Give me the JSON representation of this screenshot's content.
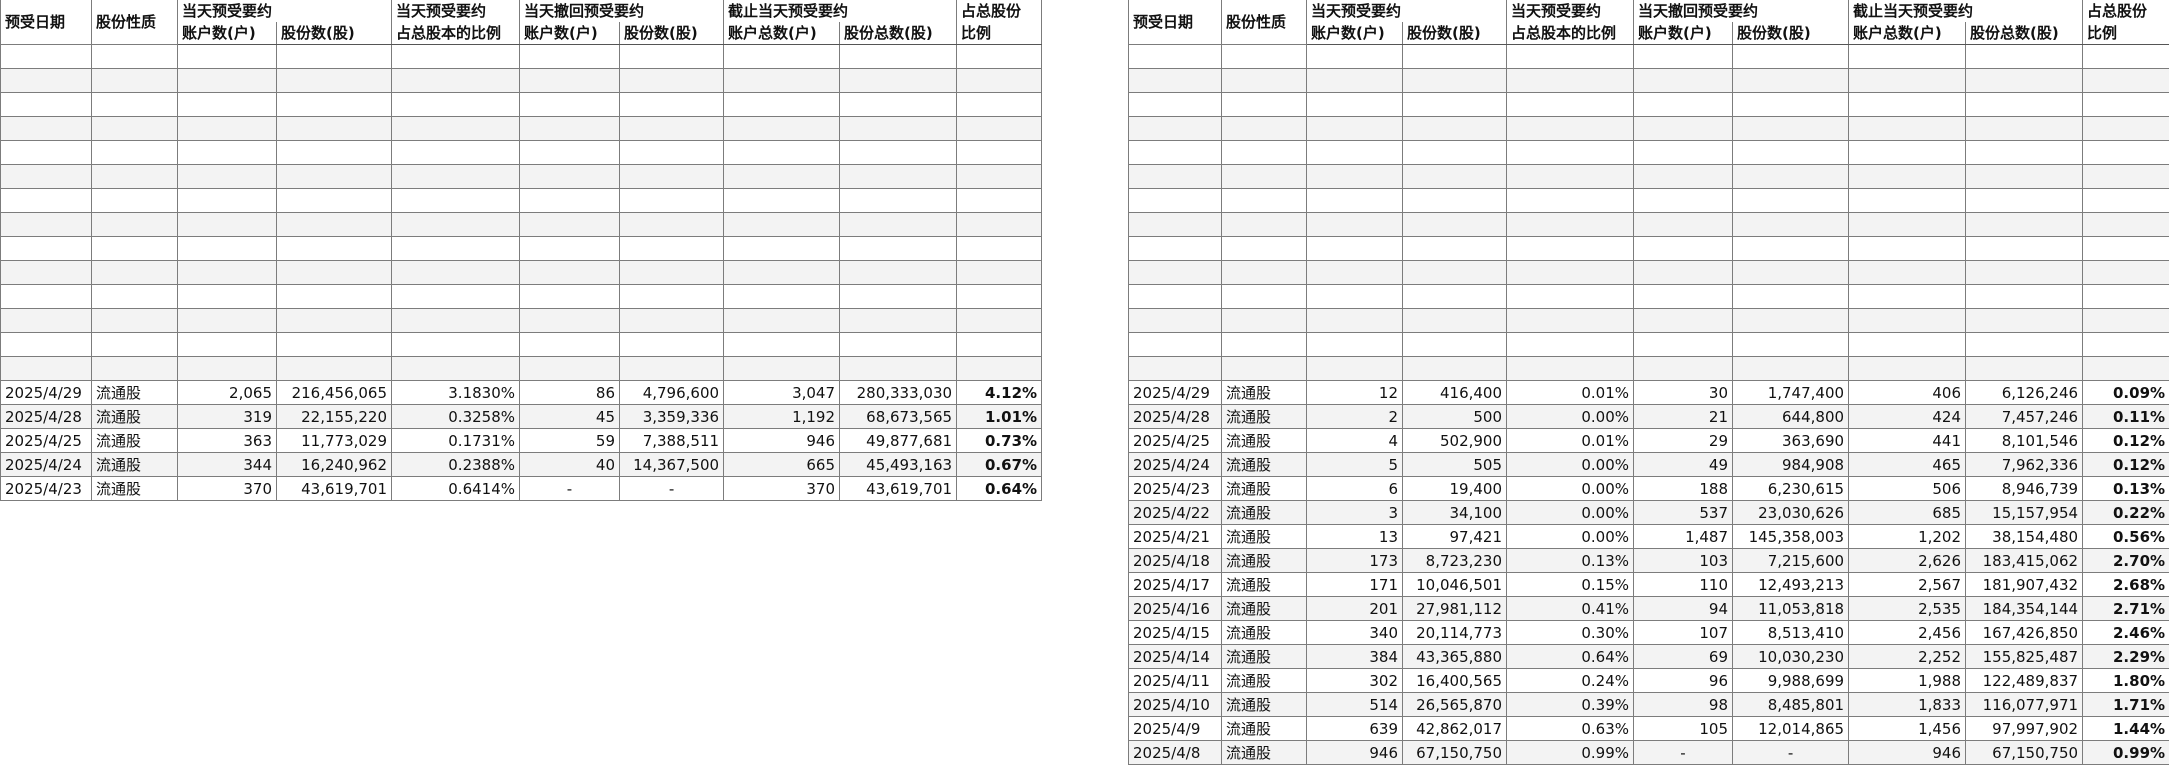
{
  "headers": {
    "date": "预受日期",
    "nature": "股份性质",
    "group_today": "当天预受要约",
    "group_ratio_a": "当天预受要约",
    "group_ratio_b": "占总股本的比例",
    "group_withdraw": "当天撤回预受要约",
    "group_cumulative": "截止当天预受要约",
    "group_total_a": "占总股份",
    "group_total_b": "比例",
    "accounts": "账户数(户)",
    "shares": "股份数(股)",
    "total_accounts": "账户总数(户)",
    "total_shares": "股份总数(股)"
  },
  "left_table": {
    "rows": [
      {
        "date": "2025/4/29",
        "nature": "流通股",
        "accounts": "2,065",
        "shares": "216,456,065",
        "ratio": "3.1830%",
        "w_accounts": "86",
        "w_shares": "4,796,600",
        "t_accounts": "3,047",
        "t_shares": "280,333,030",
        "total_ratio": "4.12%"
      },
      {
        "date": "2025/4/28",
        "nature": "流通股",
        "accounts": "319",
        "shares": "22,155,220",
        "ratio": "0.3258%",
        "w_accounts": "45",
        "w_shares": "3,359,336",
        "t_accounts": "1,192",
        "t_shares": "68,673,565",
        "total_ratio": "1.01%"
      },
      {
        "date": "2025/4/25",
        "nature": "流通股",
        "accounts": "363",
        "shares": "11,773,029",
        "ratio": "0.1731%",
        "w_accounts": "59",
        "w_shares": "7,388,511",
        "t_accounts": "946",
        "t_shares": "49,877,681",
        "total_ratio": "0.73%"
      },
      {
        "date": "2025/4/24",
        "nature": "流通股",
        "accounts": "344",
        "shares": "16,240,962",
        "ratio": "0.2388%",
        "w_accounts": "40",
        "w_shares": "14,367,500",
        "t_accounts": "665",
        "t_shares": "45,493,163",
        "total_ratio": "0.67%"
      },
      {
        "date": "2025/4/23",
        "nature": "流通股",
        "accounts": "370",
        "shares": "43,619,701",
        "ratio": "0.6414%",
        "w_accounts": "-",
        "w_shares": "-",
        "t_accounts": "370",
        "t_shares": "43,619,701",
        "total_ratio": "0.64%"
      }
    ]
  },
  "right_table": {
    "rows": [
      {
        "date": "2025/4/29",
        "nature": "流通股",
        "accounts": "12",
        "shares": "416,400",
        "ratio": "0.01%",
        "w_accounts": "30",
        "w_shares": "1,747,400",
        "t_accounts": "406",
        "t_shares": "6,126,246",
        "total_ratio": "0.09%"
      },
      {
        "date": "2025/4/28",
        "nature": "流通股",
        "accounts": "2",
        "shares": "500",
        "ratio": "0.00%",
        "w_accounts": "21",
        "w_shares": "644,800",
        "t_accounts": "424",
        "t_shares": "7,457,246",
        "total_ratio": "0.11%"
      },
      {
        "date": "2025/4/25",
        "nature": "流通股",
        "accounts": "4",
        "shares": "502,900",
        "ratio": "0.01%",
        "w_accounts": "29",
        "w_shares": "363,690",
        "t_accounts": "441",
        "t_shares": "8,101,546",
        "total_ratio": "0.12%"
      },
      {
        "date": "2025/4/24",
        "nature": "流通股",
        "accounts": "5",
        "shares": "505",
        "ratio": "0.00%",
        "w_accounts": "49",
        "w_shares": "984,908",
        "t_accounts": "465",
        "t_shares": "7,962,336",
        "total_ratio": "0.12%"
      },
      {
        "date": "2025/4/23",
        "nature": "流通股",
        "accounts": "6",
        "shares": "19,400",
        "ratio": "0.00%",
        "w_accounts": "188",
        "w_shares": "6,230,615",
        "t_accounts": "506",
        "t_shares": "8,946,739",
        "total_ratio": "0.13%"
      },
      {
        "date": "2025/4/22",
        "nature": "流通股",
        "accounts": "3",
        "shares": "34,100",
        "ratio": "0.00%",
        "w_accounts": "537",
        "w_shares": "23,030,626",
        "t_accounts": "685",
        "t_shares": "15,157,954",
        "total_ratio": "0.22%"
      },
      {
        "date": "2025/4/21",
        "nature": "流通股",
        "accounts": "13",
        "shares": "97,421",
        "ratio": "0.00%",
        "w_accounts": "1,487",
        "w_shares": "145,358,003",
        "t_accounts": "1,202",
        "t_shares": "38,154,480",
        "total_ratio": "0.56%"
      },
      {
        "date": "2025/4/18",
        "nature": "流通股",
        "accounts": "173",
        "shares": "8,723,230",
        "ratio": "0.13%",
        "w_accounts": "103",
        "w_shares": "7,215,600",
        "t_accounts": "2,626",
        "t_shares": "183,415,062",
        "total_ratio": "2.70%"
      },
      {
        "date": "2025/4/17",
        "nature": "流通股",
        "accounts": "171",
        "shares": "10,046,501",
        "ratio": "0.15%",
        "w_accounts": "110",
        "w_shares": "12,493,213",
        "t_accounts": "2,567",
        "t_shares": "181,907,432",
        "total_ratio": "2.68%"
      },
      {
        "date": "2025/4/16",
        "nature": "流通股",
        "accounts": "201",
        "shares": "27,981,112",
        "ratio": "0.41%",
        "w_accounts": "94",
        "w_shares": "11,053,818",
        "t_accounts": "2,535",
        "t_shares": "184,354,144",
        "total_ratio": "2.71%"
      },
      {
        "date": "2025/4/15",
        "nature": "流通股",
        "accounts": "340",
        "shares": "20,114,773",
        "ratio": "0.30%",
        "w_accounts": "107",
        "w_shares": "8,513,410",
        "t_accounts": "2,456",
        "t_shares": "167,426,850",
        "total_ratio": "2.46%"
      },
      {
        "date": "2025/4/14",
        "nature": "流通股",
        "accounts": "384",
        "shares": "43,365,880",
        "ratio": "0.64%",
        "w_accounts": "69",
        "w_shares": "10,030,230",
        "t_accounts": "2,252",
        "t_shares": "155,825,487",
        "total_ratio": "2.29%"
      },
      {
        "date": "2025/4/11",
        "nature": "流通股",
        "accounts": "302",
        "shares": "16,400,565",
        "ratio": "0.24%",
        "w_accounts": "96",
        "w_shares": "9,988,699",
        "t_accounts": "1,988",
        "t_shares": "122,489,837",
        "total_ratio": "1.80%"
      },
      {
        "date": "2025/4/10",
        "nature": "流通股",
        "accounts": "514",
        "shares": "26,565,870",
        "ratio": "0.39%",
        "w_accounts": "98",
        "w_shares": "8,485,801",
        "t_accounts": "1,833",
        "t_shares": "116,077,971",
        "total_ratio": "1.71%"
      },
      {
        "date": "2025/4/9",
        "nature": "流通股",
        "accounts": "639",
        "shares": "42,862,017",
        "ratio": "0.63%",
        "w_accounts": "105",
        "w_shares": "12,014,865",
        "t_accounts": "1,456",
        "t_shares": "97,997,902",
        "total_ratio": "1.44%"
      },
      {
        "date": "2025/4/8",
        "nature": "流通股",
        "accounts": "946",
        "shares": "67,150,750",
        "ratio": "0.99%",
        "w_accounts": "-",
        "w_shares": "-",
        "t_accounts": "946",
        "t_shares": "67,150,750",
        "total_ratio": "0.99%"
      }
    ]
  }
}
